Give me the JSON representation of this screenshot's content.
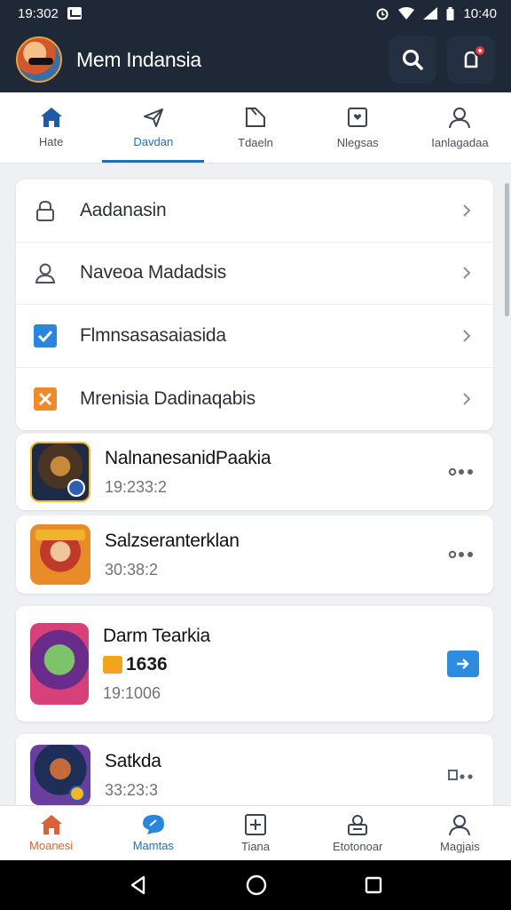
{
  "status_bar": {
    "time_left": "19:302",
    "time_right": "10:40"
  },
  "app_bar": {
    "title": "Mem Indansia"
  },
  "tabs": [
    {
      "label": "Hate",
      "icon": "home-icon",
      "active": false
    },
    {
      "label": "Davdan",
      "icon": "send-icon",
      "active": true
    },
    {
      "label": "Tdaeln",
      "icon": "tag-icon",
      "active": false
    },
    {
      "label": "Nlegsas",
      "icon": "heart-square-icon",
      "active": false
    },
    {
      "label": "Ianlagadaa",
      "icon": "person-icon",
      "active": false
    }
  ],
  "menu": [
    {
      "label": "Aadanasin",
      "icon": "lock-icon"
    },
    {
      "label": "Naveoa Madadsis",
      "icon": "user-icon"
    },
    {
      "label": "Flmnsasasaiasida",
      "icon": "checkbox-icon"
    },
    {
      "label": "Mrenisia Dadinaqabis",
      "icon": "close-box-icon"
    }
  ],
  "apps": [
    {
      "name": "NalnanesanidPaakia",
      "meta": "19:233:2",
      "action": "more"
    },
    {
      "name": "Salzseranterklan",
      "meta": "30:38:2",
      "action": "more"
    },
    {
      "name": "Darm Tearkia",
      "price": "1636",
      "meta": "19:1006",
      "action": "go"
    },
    {
      "name": "Satkda",
      "meta": "33:23:3",
      "action": "more-alt"
    }
  ],
  "bottom_nav": [
    {
      "label": "Moanesi",
      "icon": "home-icon"
    },
    {
      "label": "Mamtas",
      "icon": "chat-bubble-icon"
    },
    {
      "label": "Tiana",
      "icon": "plus-square-icon"
    },
    {
      "label": "Etotonoar",
      "icon": "badge-icon"
    },
    {
      "label": "Magjais",
      "icon": "person-icon"
    }
  ],
  "colors": {
    "appbar": "#1f2836",
    "accent": "#1f6fb8",
    "home_red": "#d9623a",
    "price_orange": "#f2a51c"
  }
}
